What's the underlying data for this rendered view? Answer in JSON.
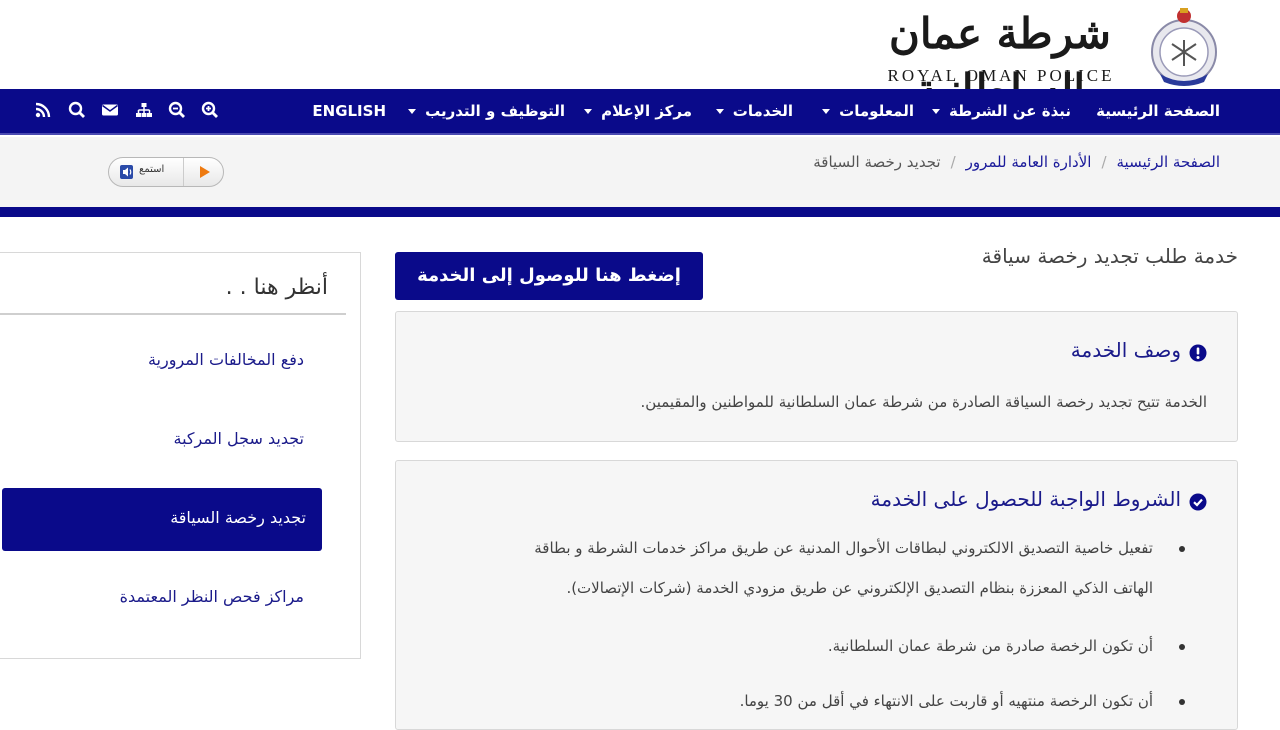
{
  "header": {
    "logo_ar": "شرطة عمان السلطانية",
    "logo_en": "ROYAL OMAN POLICE"
  },
  "nav": {
    "items": [
      {
        "label": "الصفحة الرئيسية",
        "dropdown": false
      },
      {
        "label": "نبذة عن الشرطة",
        "dropdown": true
      },
      {
        "label": "المعلومات",
        "dropdown": true
      },
      {
        "label": "الخدمات",
        "dropdown": true
      },
      {
        "label": "مركز الإعلام",
        "dropdown": true
      },
      {
        "label": "التوظيف و التدريب",
        "dropdown": true
      },
      {
        "label": "ENGLISH",
        "dropdown": false
      }
    ],
    "icons": [
      "zoom-in-icon",
      "zoom-out-icon",
      "sitemap-icon",
      "mail-icon",
      "search-icon",
      "rss-icon"
    ]
  },
  "breadcrumb": {
    "items": [
      "الصفحة الرئيسية",
      "الأدارة العامة للمرور",
      "تجديد رخصة السياقة"
    ]
  },
  "listen": {
    "label": "استمع"
  },
  "main": {
    "title": "خدمة طلب تجديد رخصة سياقة",
    "cta_label": "إضغط هنا للوصول إلى الخدمة",
    "description": {
      "title": "وصف الخدمة",
      "text": "الخدمة تتيح تجديد رخصة السياقة الصادرة من شرطة عمان السلطانية للمواطنين والمقيمين."
    },
    "conditions": {
      "title": "الشروط الواجبة للحصول على الخدمة",
      "items": [
        {
          "line1": "تفعيل خاصية التصديق الالكتروني لبطاقات الأحوال المدنية عن طريق مراكز خدمات الشرطة و بطاقة",
          "line2": "الهاتف الذكي المعززة بنظام التصديق الإلكتروني عن طريق مزودي الخدمة (شركات الإتصالات)."
        },
        {
          "line1": "أن تكون الرخصة صادرة من شرطة عمان السلطانية."
        },
        {
          "line1": "أن تكون الرخصة منتهيه أو قاربت على الانتهاء في أقل من 30 يوما."
        }
      ]
    }
  },
  "sidebar": {
    "heading": "أنظر هنا . .",
    "links": [
      {
        "label": "دفع المخالفات المرورية"
      },
      {
        "label": "تجديد سجل المركبة"
      },
      {
        "label": "تجديد رخصة السياقة",
        "active": true
      },
      {
        "label": "مراكز فحص النظر المعتمدة"
      }
    ]
  },
  "colors": {
    "brand_navy": "#0a0a8a",
    "accent_orange": "#ee7a10",
    "panel_bg": "#f6f6f6"
  }
}
